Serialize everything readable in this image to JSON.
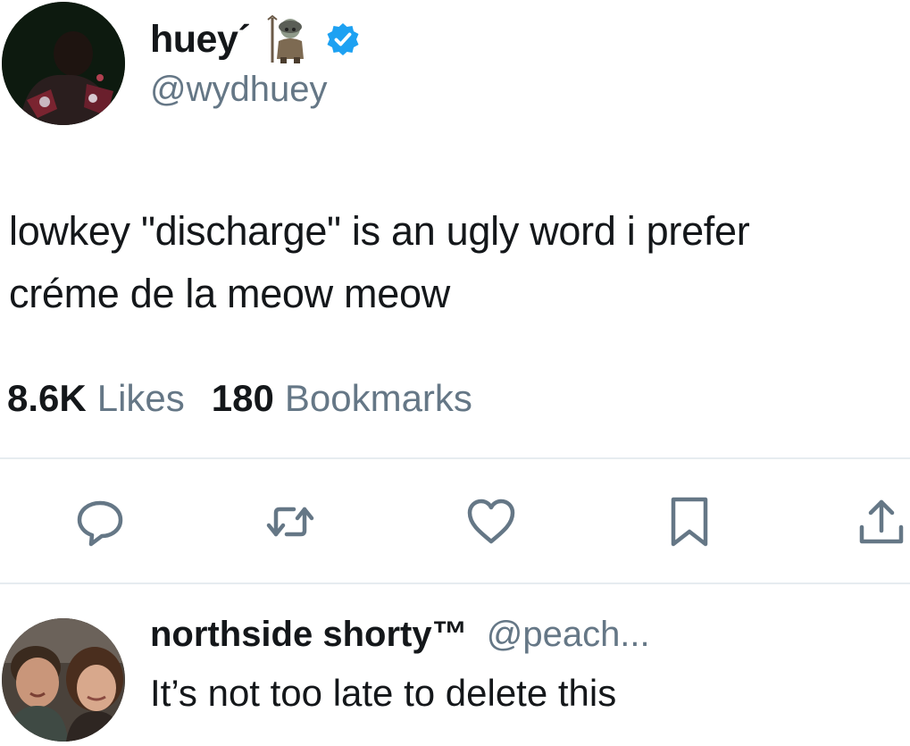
{
  "tweet": {
    "display_name": "huey´",
    "handle": "@wydhuey",
    "verified": true,
    "name_emoji": "troll-figure-emoji",
    "text_lines": [
      "lowkey \"discharge\" is an ugly word i prefer",
      "créme de la meow meow"
    ],
    "likes_count": "8.6K",
    "likes_label": "Likes",
    "bookmarks_count": "180",
    "bookmarks_label": "Bookmarks"
  },
  "actions": [
    {
      "name": "reply",
      "icon": "speech-bubble-icon"
    },
    {
      "name": "retweet",
      "icon": "retweet-icon"
    },
    {
      "name": "like",
      "icon": "heart-icon"
    },
    {
      "name": "bookmark",
      "icon": "bookmark-icon"
    },
    {
      "name": "share",
      "icon": "share-icon"
    }
  ],
  "reply": {
    "display_name": "northside shorty™",
    "handle": "@peach...",
    "text": "It’s not too late to delete this"
  },
  "colors": {
    "text_primary": "#14171a",
    "text_secondary": "#657786",
    "icon": "#657786",
    "verified": "#1da1f2",
    "divider": "#e6ecf0"
  }
}
